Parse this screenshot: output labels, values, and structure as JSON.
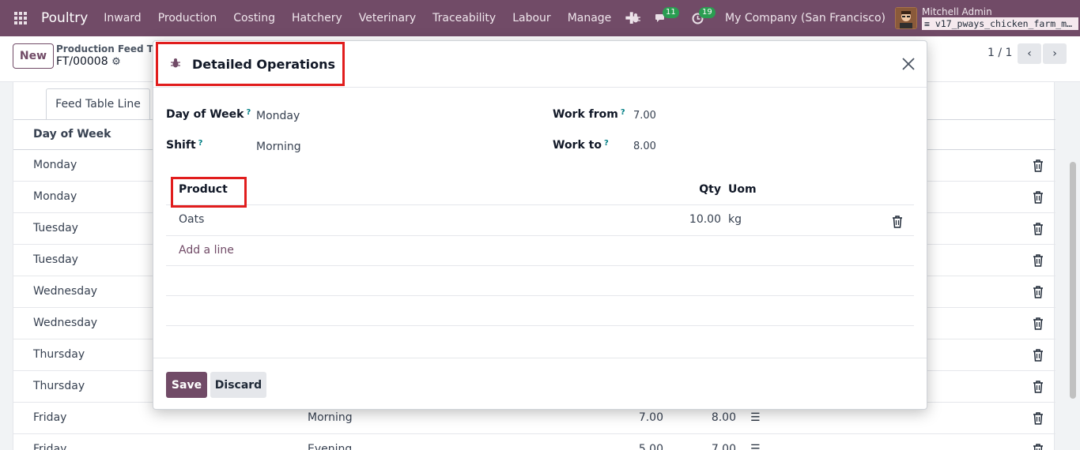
{
  "navbar": {
    "brand": "Poultry",
    "menu": [
      "Inward",
      "Production",
      "Costing",
      "Hatchery",
      "Veterinary",
      "Traceability",
      "Labour",
      "Manage"
    ],
    "plus_icon": "plus-icon",
    "messages_count": "11",
    "activities_count": "19",
    "company": "My Company (San Francisco)",
    "user_name": "Mitchell Admin",
    "database": "v17_pways_chicken_farm_m…"
  },
  "form_header": {
    "new_label": "New",
    "breadcrumb_parent": "Production Feed Tab",
    "breadcrumb_current": "FT/00008",
    "pager": "1 / 1"
  },
  "background_list": {
    "tab_label": "Feed Table Line",
    "column_day": "Day of Week",
    "rows": [
      {
        "day": "Monday",
        "shift": "",
        "from": "",
        "to": ""
      },
      {
        "day": "Monday",
        "shift": "",
        "from": "",
        "to": ""
      },
      {
        "day": "Tuesday",
        "shift": "",
        "from": "",
        "to": ""
      },
      {
        "day": "Tuesday",
        "shift": "",
        "from": "",
        "to": ""
      },
      {
        "day": "Wednesday",
        "shift": "",
        "from": "",
        "to": ""
      },
      {
        "day": "Wednesday",
        "shift": "",
        "from": "",
        "to": ""
      },
      {
        "day": "Thursday",
        "shift": "",
        "from": "",
        "to": ""
      },
      {
        "day": "Thursday",
        "shift": "",
        "from": "",
        "to": ""
      },
      {
        "day": "Friday",
        "shift": "Morning",
        "from": "7.00",
        "to": "8.00"
      },
      {
        "day": "Friday",
        "shift": "Evening",
        "from": "5.00",
        "to": "7.00"
      }
    ]
  },
  "modal": {
    "title": "Detailed Operations",
    "fields": {
      "day_of_week_label": "Day of Week",
      "day_of_week_value": "Monday",
      "shift_label": "Shift",
      "shift_value": "Morning",
      "work_from_label": "Work from",
      "work_from_value": "7.00",
      "work_to_label": "Work to",
      "work_to_value": "8.00",
      "help_mark": "?"
    },
    "lines": {
      "headers": {
        "product": "Product",
        "qty": "Qty",
        "uom": "Uom"
      },
      "rows": [
        {
          "product": "Oats",
          "qty": "10.00",
          "uom": "kg"
        }
      ],
      "add_line": "Add a line"
    },
    "save_label": "Save",
    "discard_label": "Discard"
  },
  "colors": {
    "brand": "#714b67",
    "highlight": "#e11d1d",
    "help": "#017e84"
  }
}
